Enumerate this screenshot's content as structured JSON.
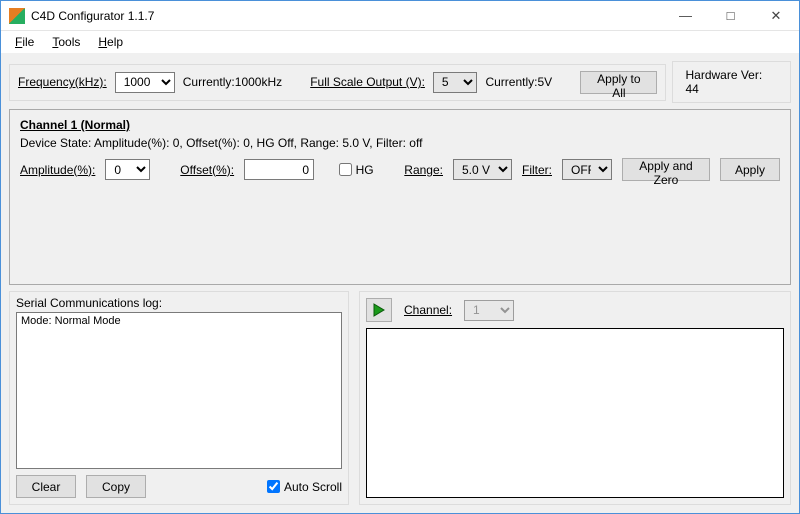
{
  "window": {
    "title": "C4D Configurator 1.1.7"
  },
  "menu": {
    "file": "File",
    "tools": "Tools",
    "help": "Help"
  },
  "top": {
    "freq_label": "Frequency(kHz):",
    "freq_value": "1000",
    "freq_current": "Currently:1000kHz",
    "fso_label": "Full Scale Output (V):",
    "fso_value": "5",
    "fso_current": "Currently:5V",
    "apply_all": "Apply to All",
    "hw_ver": "Hardware Ver: 44"
  },
  "channel": {
    "title": "Channel 1 (Normal)",
    "state": "Device State: Amplitude(%): 0, Offset(%): 0,  HG Off,  Range: 5.0 V,  Filter: off",
    "amp_label": "Amplitude(%):",
    "amp_value": "0",
    "off_label": "Offset(%):",
    "off_value": "0",
    "hg_label": "HG",
    "range_label": "Range:",
    "range_value": "5.0 V",
    "filter_label": "Filter:",
    "filter_value": "OFF",
    "apply_zero": "Apply and Zero",
    "apply": "Apply"
  },
  "log": {
    "label": "Serial Communications log:",
    "content": "Mode: Normal Mode",
    "clear": "Clear",
    "copy": "Copy",
    "autoscroll": "Auto Scroll"
  },
  "plot": {
    "channel_label": "Channel:",
    "channel_value": "1"
  }
}
